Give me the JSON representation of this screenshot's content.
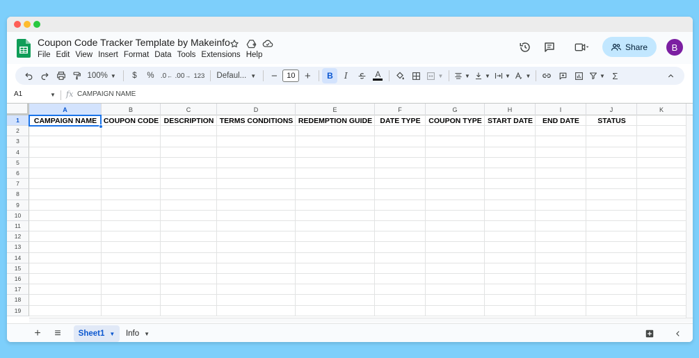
{
  "doc": {
    "title": "Coupon Code Tracker Template by Makeinfo"
  },
  "menu": [
    "File",
    "Edit",
    "View",
    "Insert",
    "Format",
    "Data",
    "Tools",
    "Extensions",
    "Help"
  ],
  "header": {
    "share_label": "Share",
    "avatar_initial": "B"
  },
  "toolbar": {
    "zoom": "100%",
    "currency": "$",
    "percent": "%",
    "dec_decrease": ".0",
    "dec_increase": ".00",
    "number_format": "123",
    "font": "Defaul...",
    "font_size": "10",
    "bold": "B",
    "italic": "I",
    "text_color_letter": "A",
    "sum": "Σ"
  },
  "formula_bar": {
    "cell_ref": "A1",
    "fx": "fx",
    "value": "CAMPAIGN NAME"
  },
  "grid": {
    "columns": [
      "A",
      "B",
      "C",
      "D",
      "E",
      "F",
      "G",
      "H",
      "I",
      "J",
      "K"
    ],
    "rows": [
      "1",
      "2",
      "3",
      "4",
      "5",
      "6",
      "7",
      "8",
      "9",
      "10",
      "11",
      "12",
      "13",
      "14",
      "15",
      "16",
      "17",
      "18",
      "19"
    ],
    "header_cells": [
      "CAMPAIGN NAME",
      "COUPON CODE",
      "DESCRIPTION",
      "TERMS CONDITIONS",
      "REDEMPTION GUIDE",
      "DATE TYPE",
      "COUPON TYPE",
      "START DATE",
      "END DATE",
      "STATUS",
      ""
    ]
  },
  "sheets": {
    "add": "+",
    "list": "≡",
    "tabs": [
      "Sheet1",
      "Info"
    ],
    "active": "Sheet1"
  },
  "colors": {
    "accent": "#1a73e8",
    "share_bg": "#c2e7ff",
    "avatar_bg": "#7b1fa2",
    "sheets_green": "#0f9d58"
  }
}
